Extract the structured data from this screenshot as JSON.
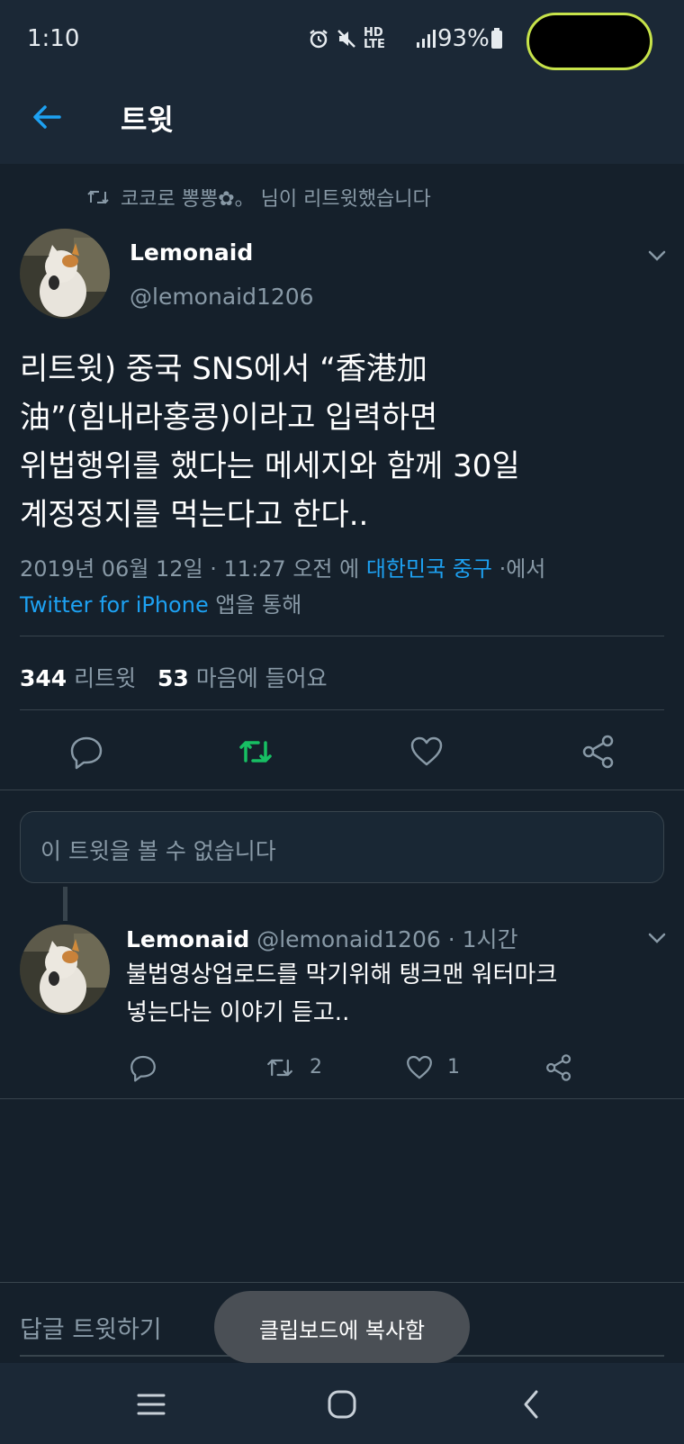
{
  "status_bar": {
    "time": "1:10",
    "network": "HD LTE",
    "battery": "93%"
  },
  "app_bar": {
    "title": "트윗"
  },
  "retweet_header": {
    "text": "코코로 뽕뽕✿。 님이 리트윗했습니다"
  },
  "tweet": {
    "author_name": "Lemonaid",
    "author_handle": "@lemonaid1206",
    "text_lines": [
      "리트윗) 중국 SNS에서 “香港加",
      "油”(힘내라홍콩)이라고 입력하면",
      "위법행위를 했다는 메세지와 함께 30일",
      "계정정지를 먹는다고 한다.."
    ],
    "meta_date": "2019년 06월 12일 · 11:27 오전 에 ",
    "meta_location": "대한민국 중구",
    "meta_suffix": " ·에서",
    "meta_client": "Twitter for iPhone",
    "meta_client_suffix": " 앱을 통해",
    "retweet_count": "344",
    "retweet_label": " 리트윗",
    "like_count": "53",
    "like_label": " 마음에 들어요"
  },
  "unavailable_tweet": {
    "text": "이 트윗을 볼 수 없습니다"
  },
  "reply": {
    "author_name": "Lemonaid",
    "author_handle": " @lemonaid1206 · 1시간",
    "text_lines": [
      "불법영상업로드를 막기위해 탱크맨 워터마크",
      "넣는다는 이야기 듣고.."
    ],
    "retweet_count": "2",
    "like_count": "1"
  },
  "composer": {
    "placeholder": "답글 트윗하기"
  },
  "toast": {
    "text": "클립보드에 복사함"
  },
  "colors": {
    "background": "#15202b",
    "bar": "#1b2836",
    "accent": "#1da1f2",
    "retweet_active": "#17bf63",
    "secondary_text": "#8899a6"
  }
}
